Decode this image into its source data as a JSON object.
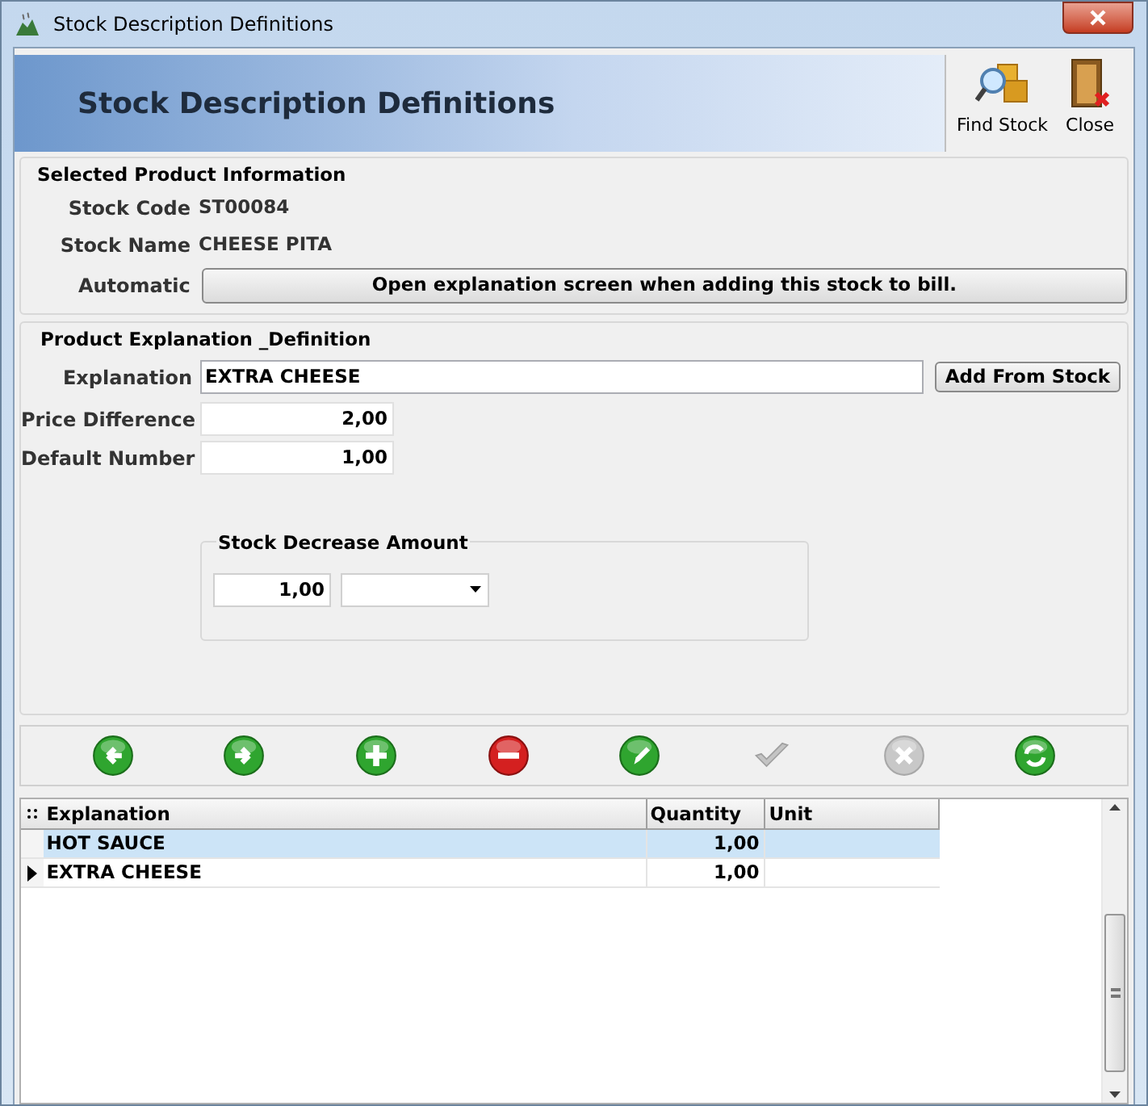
{
  "window": {
    "title": "Stock Description Definitions"
  },
  "header": {
    "title": "Stock Description Definitions",
    "actions": [
      {
        "kind": "find",
        "label": "Find Stock"
      },
      {
        "kind": "close",
        "label": "Close"
      }
    ]
  },
  "product_info": {
    "title": "Selected Product Information",
    "stock_code_label": "Stock Code",
    "stock_code": "ST00084",
    "stock_name_label": "Stock Name",
    "stock_name": "CHEESE PITA",
    "automatic_label": "Automatic",
    "automatic_button": "Open explanation screen when adding this stock to bill."
  },
  "definition": {
    "title": "Product Explanation _Definition",
    "explanation_label": "Explanation",
    "explanation": "EXTRA CHEESE",
    "add_button": "Add From Stock",
    "price_label": "Price Difference",
    "price": "2,00",
    "default_label": "Default Number",
    "default_number": "1,00",
    "decrease": {
      "title": "Stock Decrease Amount",
      "amount": "1,00"
    }
  },
  "toolbar": [
    {
      "kind": "back",
      "disabled": false
    },
    {
      "kind": "forward",
      "disabled": false
    },
    {
      "kind": "add",
      "disabled": false
    },
    {
      "kind": "remove",
      "disabled": false
    },
    {
      "kind": "edit",
      "disabled": false
    },
    {
      "kind": "confirm",
      "disabled": true
    },
    {
      "kind": "cancel",
      "disabled": true
    },
    {
      "kind": "refresh",
      "disabled": false
    }
  ],
  "table": {
    "columns": [
      "Explanation",
      "Quantity",
      "Unit"
    ],
    "rows": [
      {
        "explanation": "HOT SAUCE",
        "quantity": "1,00",
        "selected": true,
        "current": false
      },
      {
        "explanation": "EXTRA CHEESE",
        "quantity": "1,00",
        "selected": false,
        "current": true
      }
    ]
  }
}
